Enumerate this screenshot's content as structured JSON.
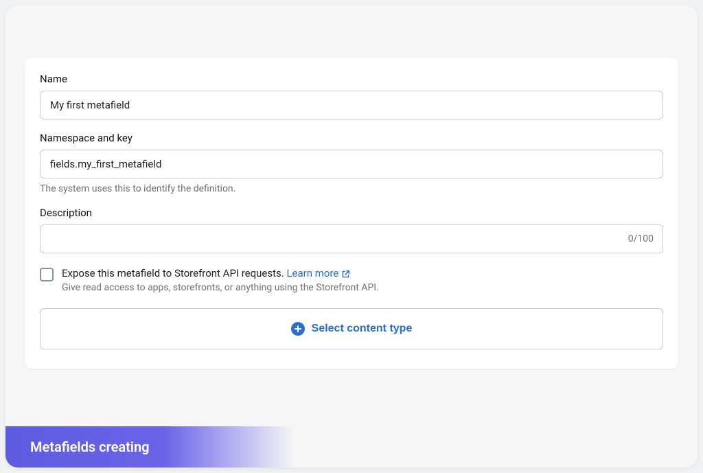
{
  "form": {
    "name": {
      "label": "Name",
      "value": "My first metafield"
    },
    "namespace": {
      "label": "Namespace and key",
      "value": "fields.my_first_metafield",
      "helper": "The system uses this to identify the definition."
    },
    "description": {
      "label": "Description",
      "value": "",
      "char_count": "0/100"
    },
    "expose": {
      "label_prefix": "Expose this metafield to Storefront API requests. ",
      "learn_more": "Learn more",
      "sublabel": "Give read access to apps, storefronts, or anything using the Storefront API."
    },
    "select_button": "Select content type"
  },
  "caption": "Metafields creating"
}
